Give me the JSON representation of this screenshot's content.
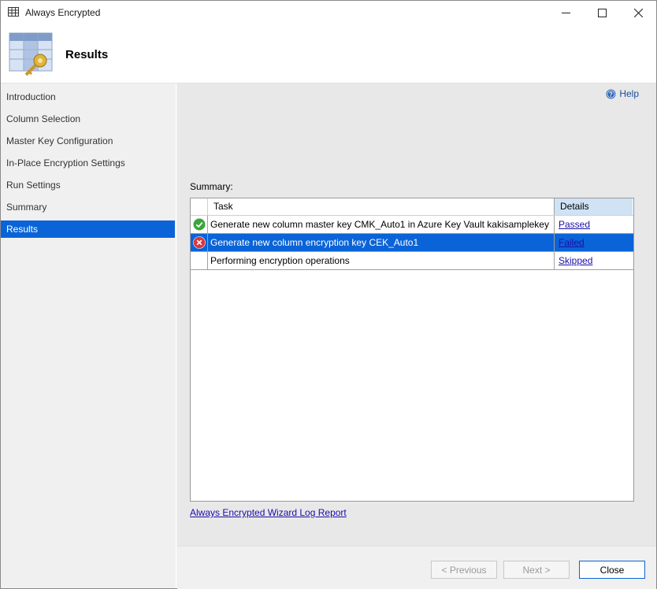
{
  "window": {
    "title": "Always Encrypted"
  },
  "header": {
    "title": "Results"
  },
  "sidebar": {
    "items": [
      {
        "label": "Introduction"
      },
      {
        "label": "Column Selection"
      },
      {
        "label": "Master Key Configuration"
      },
      {
        "label": "In-Place Encryption Settings"
      },
      {
        "label": "Run Settings"
      },
      {
        "label": "Summary"
      },
      {
        "label": "Results"
      }
    ],
    "active": "Results"
  },
  "help": {
    "label": "Help"
  },
  "summary": {
    "label": "Summary:",
    "columns": {
      "task": "Task",
      "details": "Details"
    },
    "rows": [
      {
        "status_icon": "success-check-icon",
        "task": "Generate new column master key CMK_Auto1 in Azure Key Vault kakisamplekey",
        "detail": "Passed"
      },
      {
        "status_icon": "error-x-icon",
        "task": "Generate new column encryption key CEK_Auto1",
        "detail": "Failed"
      },
      {
        "status_icon": "",
        "task": "Performing encryption operations",
        "detail": "Skipped"
      }
    ]
  },
  "log_link": "Always Encrypted Wizard Log Report",
  "footer": {
    "previous": "< Previous",
    "next": "Next >",
    "close": "Close"
  },
  "colors": {
    "accent": "#0a64d7",
    "success": "#3aa53a",
    "error": "#d9363e",
    "link": "#1a0dab"
  }
}
